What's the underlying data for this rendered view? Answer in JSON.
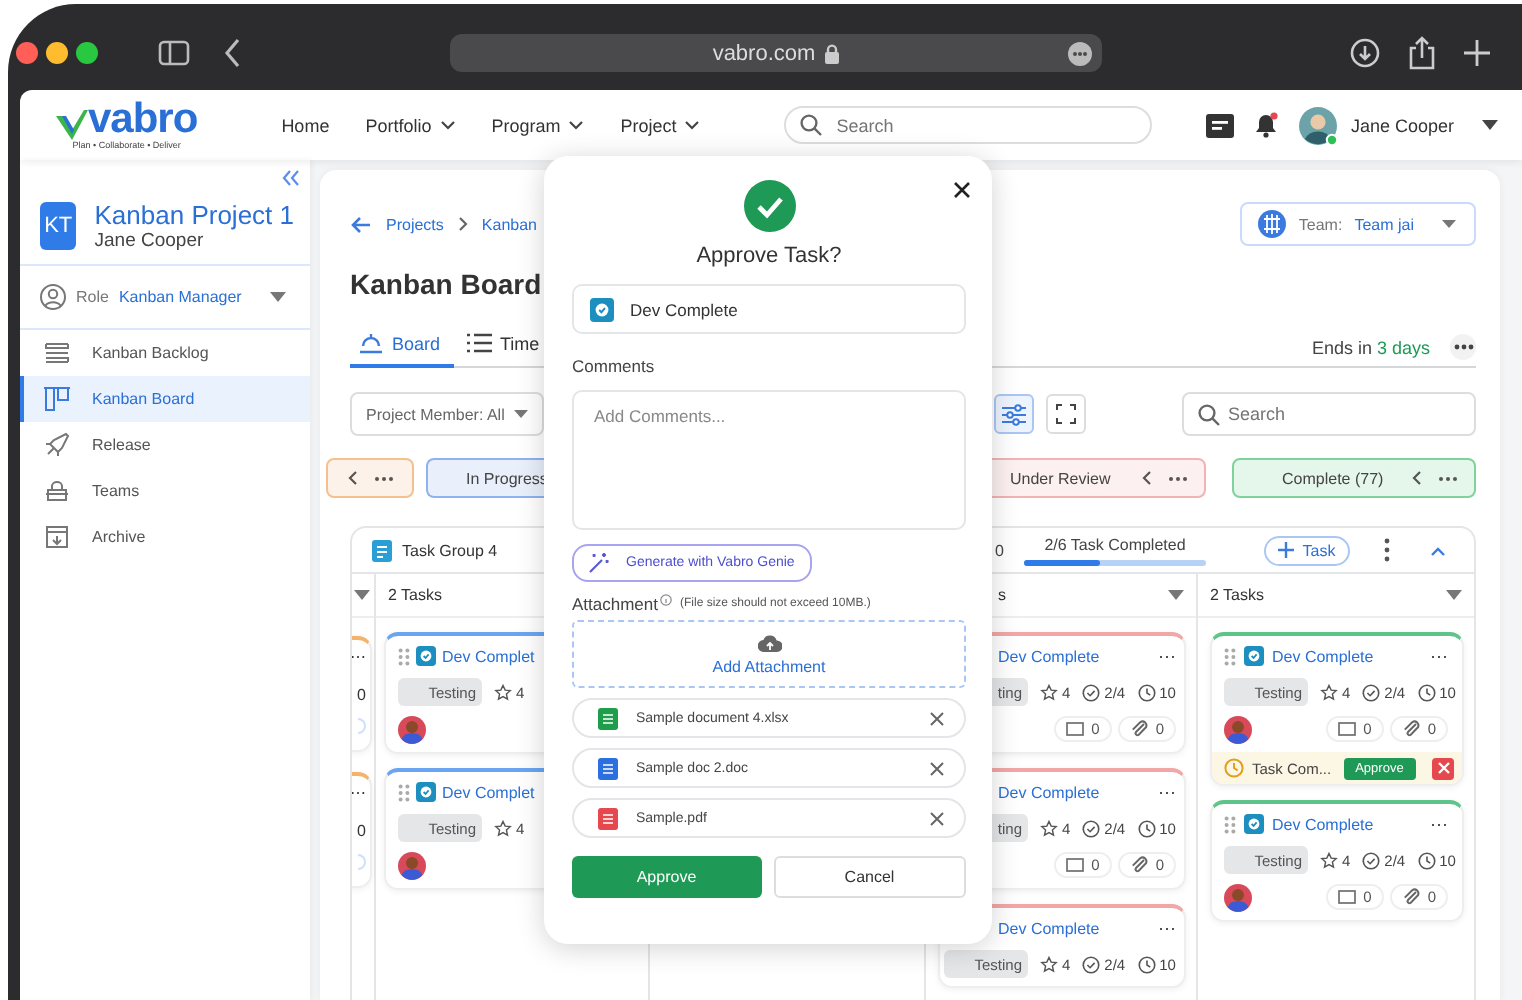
{
  "browser": {
    "url": "vabro.com"
  },
  "header": {
    "logo": "vabro",
    "tagline": "Plan • Collaborate • Deliver",
    "nav": [
      {
        "label": "Home",
        "menu": false
      },
      {
        "label": "Portfolio",
        "menu": true
      },
      {
        "label": "Program",
        "menu": true
      },
      {
        "label": "Project",
        "menu": true
      }
    ],
    "search": {
      "placeholder": "Search"
    },
    "user": {
      "name": "Jane Cooper"
    }
  },
  "sidebar": {
    "project": {
      "initials": "KT",
      "name": "Kanban Project 1",
      "owner": "Jane Cooper"
    },
    "role": {
      "label": "Role",
      "value": "Kanban Manager"
    },
    "items": [
      {
        "label": "Kanban Backlog",
        "selected": false
      },
      {
        "label": "Kanban Board",
        "selected": true
      },
      {
        "label": "Release",
        "selected": false
      },
      {
        "label": "Teams",
        "selected": false
      },
      {
        "label": "Archive",
        "selected": false
      }
    ]
  },
  "board": {
    "breadcrumb": [
      "Projects",
      "Kanban"
    ],
    "team": {
      "label": "Team:",
      "value": "Team jai"
    },
    "title": "Kanban Board",
    "tabs": [
      {
        "label": "Board",
        "selected": true
      },
      {
        "label": "Time",
        "selected": false
      }
    ],
    "deadline": {
      "label": "Ends in",
      "value": "3 days"
    },
    "member_filter": "Project Member: All",
    "search": {
      "placeholder": "Search"
    },
    "statuses": [
      {
        "color": "#f5c08f",
        "controls": true
      },
      {
        "label": "In Progress",
        "color": "#8fb3f0",
        "controls": false
      },
      {
        "label": "Under Review",
        "color": "#f2b3b3",
        "controls": true
      },
      {
        "label": "Complete (77)",
        "color": "#7fd39a",
        "controls": true
      }
    ],
    "group": {
      "name": "Task Group 4",
      "count": "0",
      "progress": {
        "label": "2/6 Task Completed",
        "level": 0.42
      },
      "add_task": "Task",
      "columns": [
        {
          "kind": "stub",
          "color": "#f5b26b",
          "cards": [
            {
              "more": "⋯",
              "count": "0"
            },
            {
              "more": "⋯",
              "count": "0"
            }
          ]
        },
        {
          "kind": "left",
          "heading": "2 Tasks",
          "color": "#6aa5f2",
          "cards": [
            {
              "title": "Dev Complet",
              "tag": "Testing",
              "rating": "4",
              "avatar": true
            },
            {
              "title": "Dev Complet",
              "tag": "Testing",
              "rating": "4",
              "avatar": true
            }
          ]
        },
        {
          "kind": "cut",
          "heading": "s",
          "color": "#f2a7a7",
          "cards": [
            {
              "title": "Dev Complete",
              "more": "⋯",
              "tag": "ting",
              "rating": "4",
              "checks": "2/4",
              "time": "10",
              "comments": "0",
              "attachments": "0"
            },
            {
              "title": "Dev Complete",
              "more": "⋯",
              "tag": "ting",
              "rating": "4",
              "checks": "2/4",
              "time": "10",
              "comments": "0",
              "attachments": "0"
            },
            {
              "title": "Dev Complete",
              "more": "⋯",
              "tag": "Testing",
              "rating": "4",
              "checks": "2/4",
              "time": "10"
            }
          ]
        },
        {
          "kind": "full",
          "heading": "2 Tasks",
          "color": "#5fc48a",
          "cards": [
            {
              "title": "Dev Complete",
              "more": "⋯",
              "tag": "Testing",
              "rating": "4",
              "checks": "2/4",
              "time": "10",
              "comments": "0",
              "attachments": "0",
              "avatar": true,
              "approval": {
                "text": "Task Com...",
                "action": "Approve"
              }
            },
            {
              "title": "Dev Complete",
              "more": "⋯",
              "tag": "Testing",
              "rating": "4",
              "checks": "2/4",
              "time": "10",
              "comments": "0",
              "attachments": "0",
              "avatar": true
            }
          ]
        }
      ]
    }
  },
  "modal": {
    "title": "Approve Task?",
    "task": "Dev Complete",
    "comments_label": "Comments",
    "comments_placeholder": "Add Comments...",
    "genie": "Generate with Vabro Genie",
    "attachment_label": "Attachment",
    "attachment_note": "(File size should not exceed 10MB.)",
    "add_attachment": "Add Attachment",
    "files": [
      {
        "name": "Sample document 4.xlsx",
        "kind": "xlsx"
      },
      {
        "name": "Sample doc 2.doc",
        "kind": "doc"
      },
      {
        "name": "Sample.pdf",
        "kind": "pdf"
      }
    ],
    "approve": "Approve",
    "cancel": "Cancel"
  }
}
